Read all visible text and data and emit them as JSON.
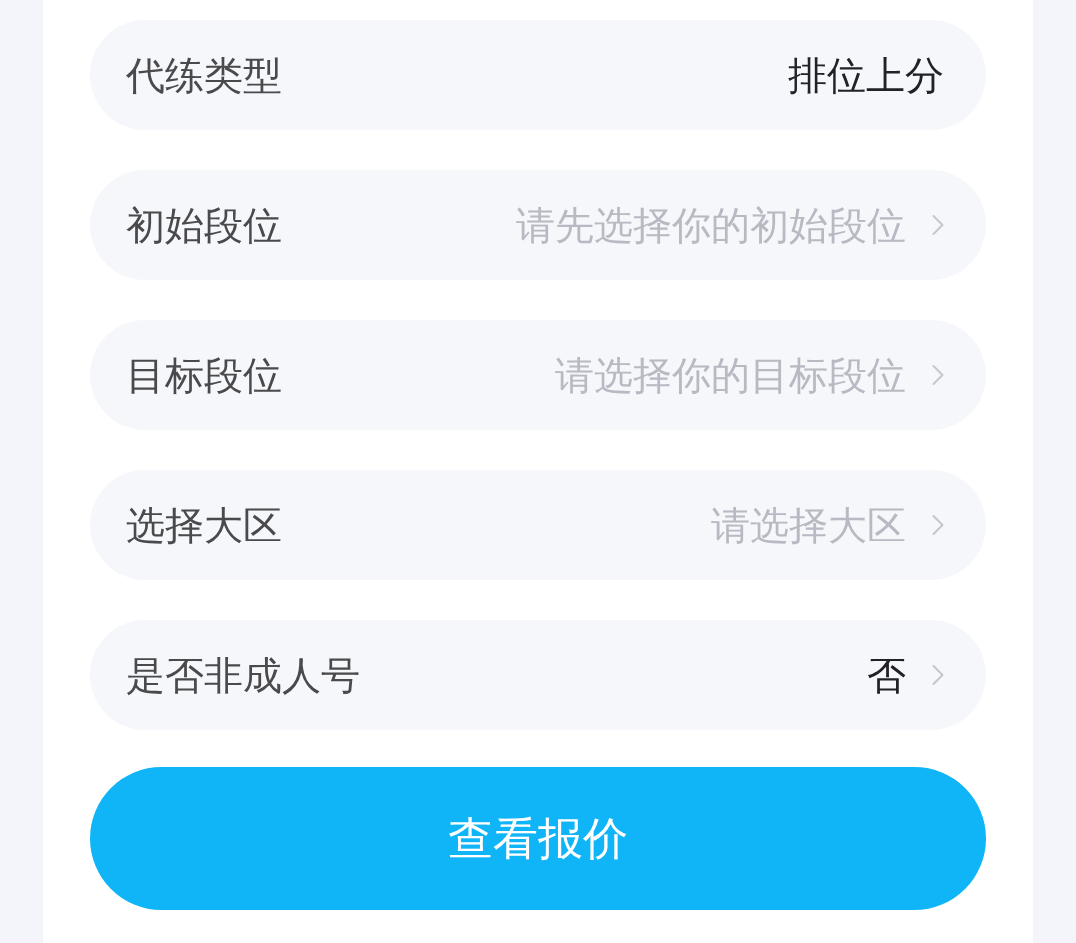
{
  "form_rows": [
    {
      "label": "代练类型",
      "value": "排位上分",
      "chevron": false
    },
    {
      "label": "初始段位",
      "placeholder": "请先选择你的初始段位",
      "chevron": true
    },
    {
      "label": "目标段位",
      "placeholder": "请选择你的目标段位",
      "chevron": true
    },
    {
      "label": "选择大区",
      "placeholder": "请选择大区",
      "chevron": true
    },
    {
      "label": "是否非成人号",
      "value": "否",
      "chevron": true
    }
  ],
  "submit_button": {
    "label": "查看报价"
  }
}
